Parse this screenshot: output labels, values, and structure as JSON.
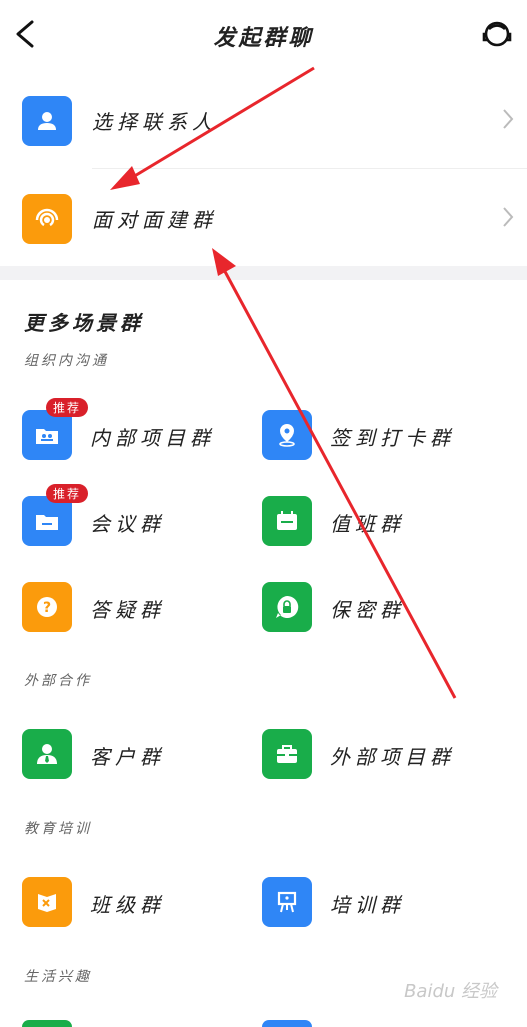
{
  "header": {
    "title": "发起群聊",
    "back_icon": "back-arrow-icon",
    "service_icon": "headset-icon"
  },
  "top_rows": [
    {
      "label": "选择联系人",
      "icon": "person-icon",
      "color": "#2f86f6"
    },
    {
      "label": "面对面建群",
      "icon": "signal-icon",
      "color": "#fb9b0c"
    }
  ],
  "more": {
    "title": "更多场景群",
    "sections": [
      {
        "title": "组织内沟通",
        "items": [
          {
            "label": "内部项目群",
            "icon": "folder-group-icon",
            "color": "#2f86f6",
            "badge": "推荐"
          },
          {
            "label": "签到打卡群",
            "icon": "location-pin-icon",
            "color": "#2f86f6",
            "badge": ""
          },
          {
            "label": "会议群",
            "icon": "folder-icon",
            "color": "#2f86f6",
            "badge": "推荐"
          },
          {
            "label": "值班群",
            "icon": "calendar-icon",
            "color": "#19ad4a",
            "badge": ""
          },
          {
            "label": "答疑群",
            "icon": "question-icon",
            "color": "#fb9b0c",
            "badge": ""
          },
          {
            "label": "保密群",
            "icon": "lock-bubble-icon",
            "color": "#19ad4a",
            "badge": ""
          }
        ]
      },
      {
        "title": "外部合作",
        "items": [
          {
            "label": "客户群",
            "icon": "customer-icon",
            "color": "#19ad4a",
            "badge": ""
          },
          {
            "label": "外部项目群",
            "icon": "briefcase-icon",
            "color": "#19ad4a",
            "badge": ""
          }
        ]
      },
      {
        "title": "教育培训",
        "items": [
          {
            "label": "班级群",
            "icon": "book-icon",
            "color": "#fb9b0c",
            "badge": ""
          },
          {
            "label": "培训群",
            "icon": "easel-icon",
            "color": "#2f86f6",
            "badge": ""
          }
        ]
      },
      {
        "title": "生活兴趣",
        "items": []
      }
    ]
  },
  "watermark": "Baidu 经验"
}
